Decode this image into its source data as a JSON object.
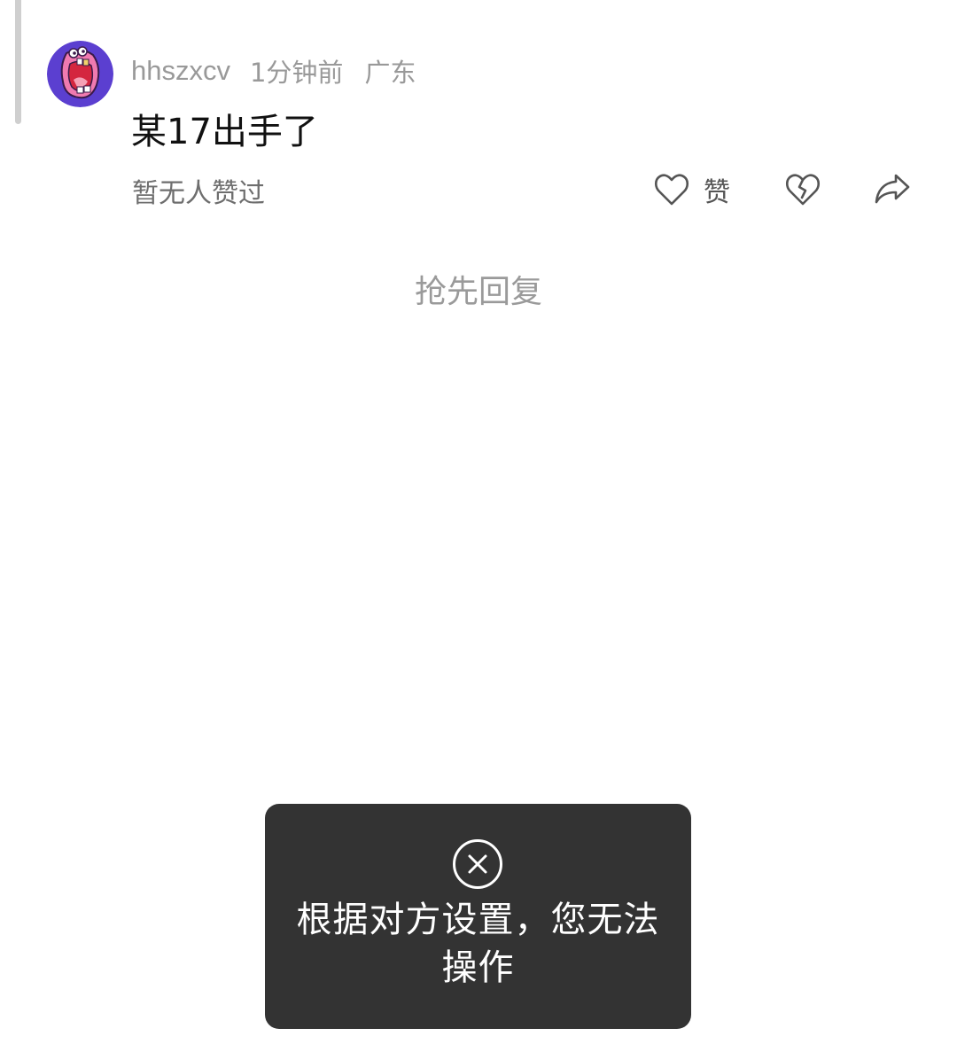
{
  "comment": {
    "username": "hhszxcv",
    "time": "1分钟前",
    "location": "广东",
    "text": "某17出手了",
    "likes_status": "暂无人赞过",
    "like_label": "赞"
  },
  "reply_prompt": "抢先回复",
  "toast": {
    "message": "根据对方设置，您无法操作",
    "icon": "close-circle-icon"
  },
  "colors": {
    "avatar_bg": "#5b3fd0",
    "avatar_face": "#f07ab0",
    "toast_bg": "#333333"
  }
}
